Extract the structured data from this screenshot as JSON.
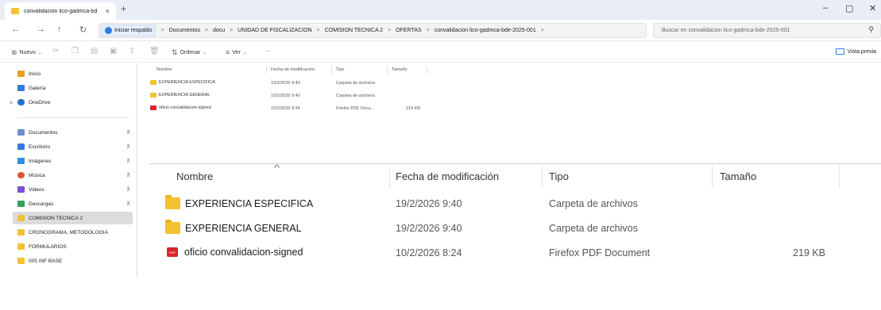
{
  "tab": {
    "title": "convalidacion lico-gadmca-bd",
    "close": "×",
    "new": "+"
  },
  "window": {
    "minimize": "–",
    "maximize": "▢",
    "close": "✕"
  },
  "nav": {
    "back": "←",
    "forward": "→",
    "up": "↑",
    "refresh": "↻"
  },
  "address": {
    "home": "Iniciar respaldo",
    "crumbs": [
      "Documentos",
      "docu",
      "UNIDAD DE FISCALIZACION",
      "COMISION TECNICA 2",
      "OFERTAS",
      "convalidacion lico-gadmca-bde-2025-001"
    ],
    "separator": ">"
  },
  "search": {
    "placeholder": "Buscar en convalidacion lico-gadmca-bde-2025-001",
    "icon": "search-icon"
  },
  "toolbar": {
    "new_label": "Nuevo",
    "sort_label": "Ordenar",
    "view_label": "Ver",
    "more_label": "···",
    "preview_label": "Vista previa"
  },
  "sidebar": {
    "items": [
      {
        "label": "Inicio",
        "color": "#e8a21f"
      },
      {
        "label": "Galería",
        "color": "#2f7de0"
      },
      {
        "label": "OneDrive",
        "color": "#1f6fd1"
      },
      {
        "label": "Documentos",
        "color": "#6d8fc7"
      },
      {
        "label": "Escritorio",
        "color": "#2f7de0"
      },
      {
        "label": "Imágenes",
        "color": "#2f8fe0"
      },
      {
        "label": "Música",
        "color": "#e0502f"
      },
      {
        "label": "Videos",
        "color": "#7a4fd1"
      },
      {
        "label": "Descargas",
        "color": "#2fa35a"
      },
      {
        "label": "COMISION TECNICA 2",
        "color": "#f2c233"
      },
      {
        "label": "CRONOGRAMA, METODOLOGIA",
        "color": "#f2c233"
      },
      {
        "label": "FORMULARIOS",
        "color": "#f2c233"
      },
      {
        "label": "005 INF BASE",
        "color": "#f2c233"
      }
    ],
    "pin": "⊼",
    "chevron": ">"
  },
  "columns": {
    "name": "Nombre",
    "modified": "Fecha de modificación",
    "type": "Tipo",
    "size": "Tamaño"
  },
  "files_small": [
    {
      "name": "EXPERIENCIA ESPECIFICA",
      "modified": "19/2/2026 9:40",
      "type": "Carpeta de archivos",
      "size": ""
    },
    {
      "name": "EXPERIENCIA GENERAL",
      "modified": "19/2/2026 9:40",
      "type": "Carpeta de archivos",
      "size": ""
    },
    {
      "name": "oficio convalidacion-signed",
      "modified": "10/2/2026 8:24",
      "type": "Firefox PDF Docu...",
      "size": "219 KB"
    }
  ],
  "files": [
    {
      "name": "EXPERIENCIA ESPECIFICA",
      "modified": "19/2/2026 9:40",
      "type": "Carpeta de archivos",
      "size": ""
    },
    {
      "name": "EXPERIENCIA GENERAL",
      "modified": "19/2/2026 9:40",
      "type": "Carpeta de archivos",
      "size": ""
    },
    {
      "name": "oficio convalidacion-signed",
      "modified": "10/2/2026 8:24",
      "type": "Firefox PDF Document",
      "size": "219 KB"
    }
  ],
  "pdf_badge": "PDF"
}
